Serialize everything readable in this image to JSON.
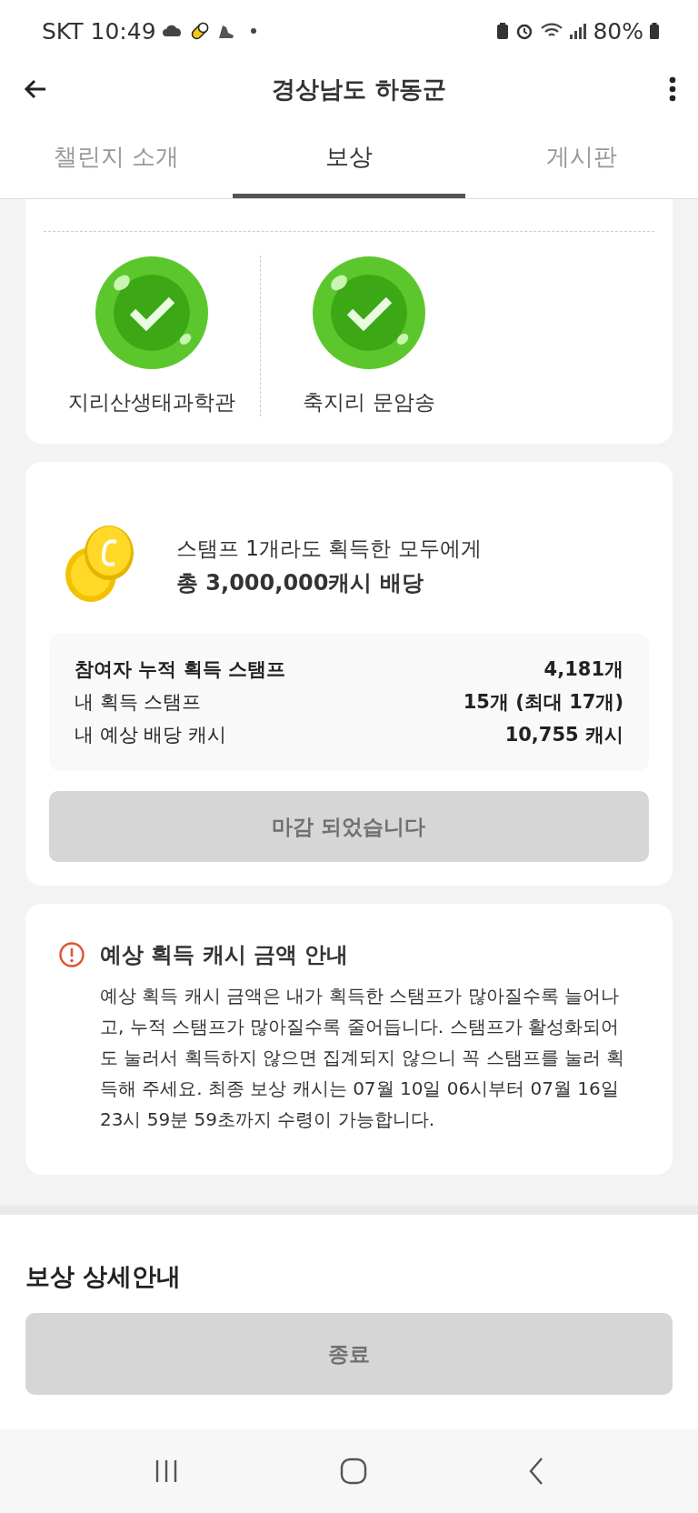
{
  "status_bar": {
    "carrier": "SKT",
    "time": "10:49",
    "battery": "80%"
  },
  "app_bar": {
    "title": "경상남도 하동군"
  },
  "tabs": [
    {
      "label": "챌린지 소개",
      "selected": false
    },
    {
      "label": "보상",
      "selected": true
    },
    {
      "label": "게시판",
      "selected": false
    }
  ],
  "stamps": [
    {
      "name": "지리산생태과학관",
      "collected": true
    },
    {
      "name": "축지리 문암송",
      "collected": true
    }
  ],
  "reward": {
    "headline": "스탬프 1개라도 획득한 모두에게",
    "amount": "총 3,000,000캐시 배당",
    "stats": [
      {
        "label": "참여자 누적 획득 스탬프",
        "value": "4,181개",
        "emphasized": true
      },
      {
        "label": "내 획득 스탬프",
        "value": "15개 (최대 17개)",
        "emphasized": false
      },
      {
        "label": "내 예상 배당 캐시",
        "value": "10,755 캐시",
        "emphasized": false
      }
    ],
    "button": {
      "label": "마감 되었습니다",
      "disabled": true
    }
  },
  "notice": {
    "title": "예상 획득 캐시 금액 안내",
    "body": "예상 획득 캐시 금액은 내가 획득한 스탬프가 많아질수록 늘어나고, 누적 스탬프가 많아질수록 줄어듭니다. 스탬프가 활성화되어도 눌러서 획득하지 않으면 집계되지 않으니 꼭 스탬프를 눌러 획득해 주세요. 최종 보상 캐시는 07월 10일 06시부터 07월 16일 23시 59분 59초까지 수령이 가능합니다."
  },
  "details": {
    "title": "보상 상세안내",
    "button": {
      "label": "종료",
      "disabled": true
    }
  }
}
